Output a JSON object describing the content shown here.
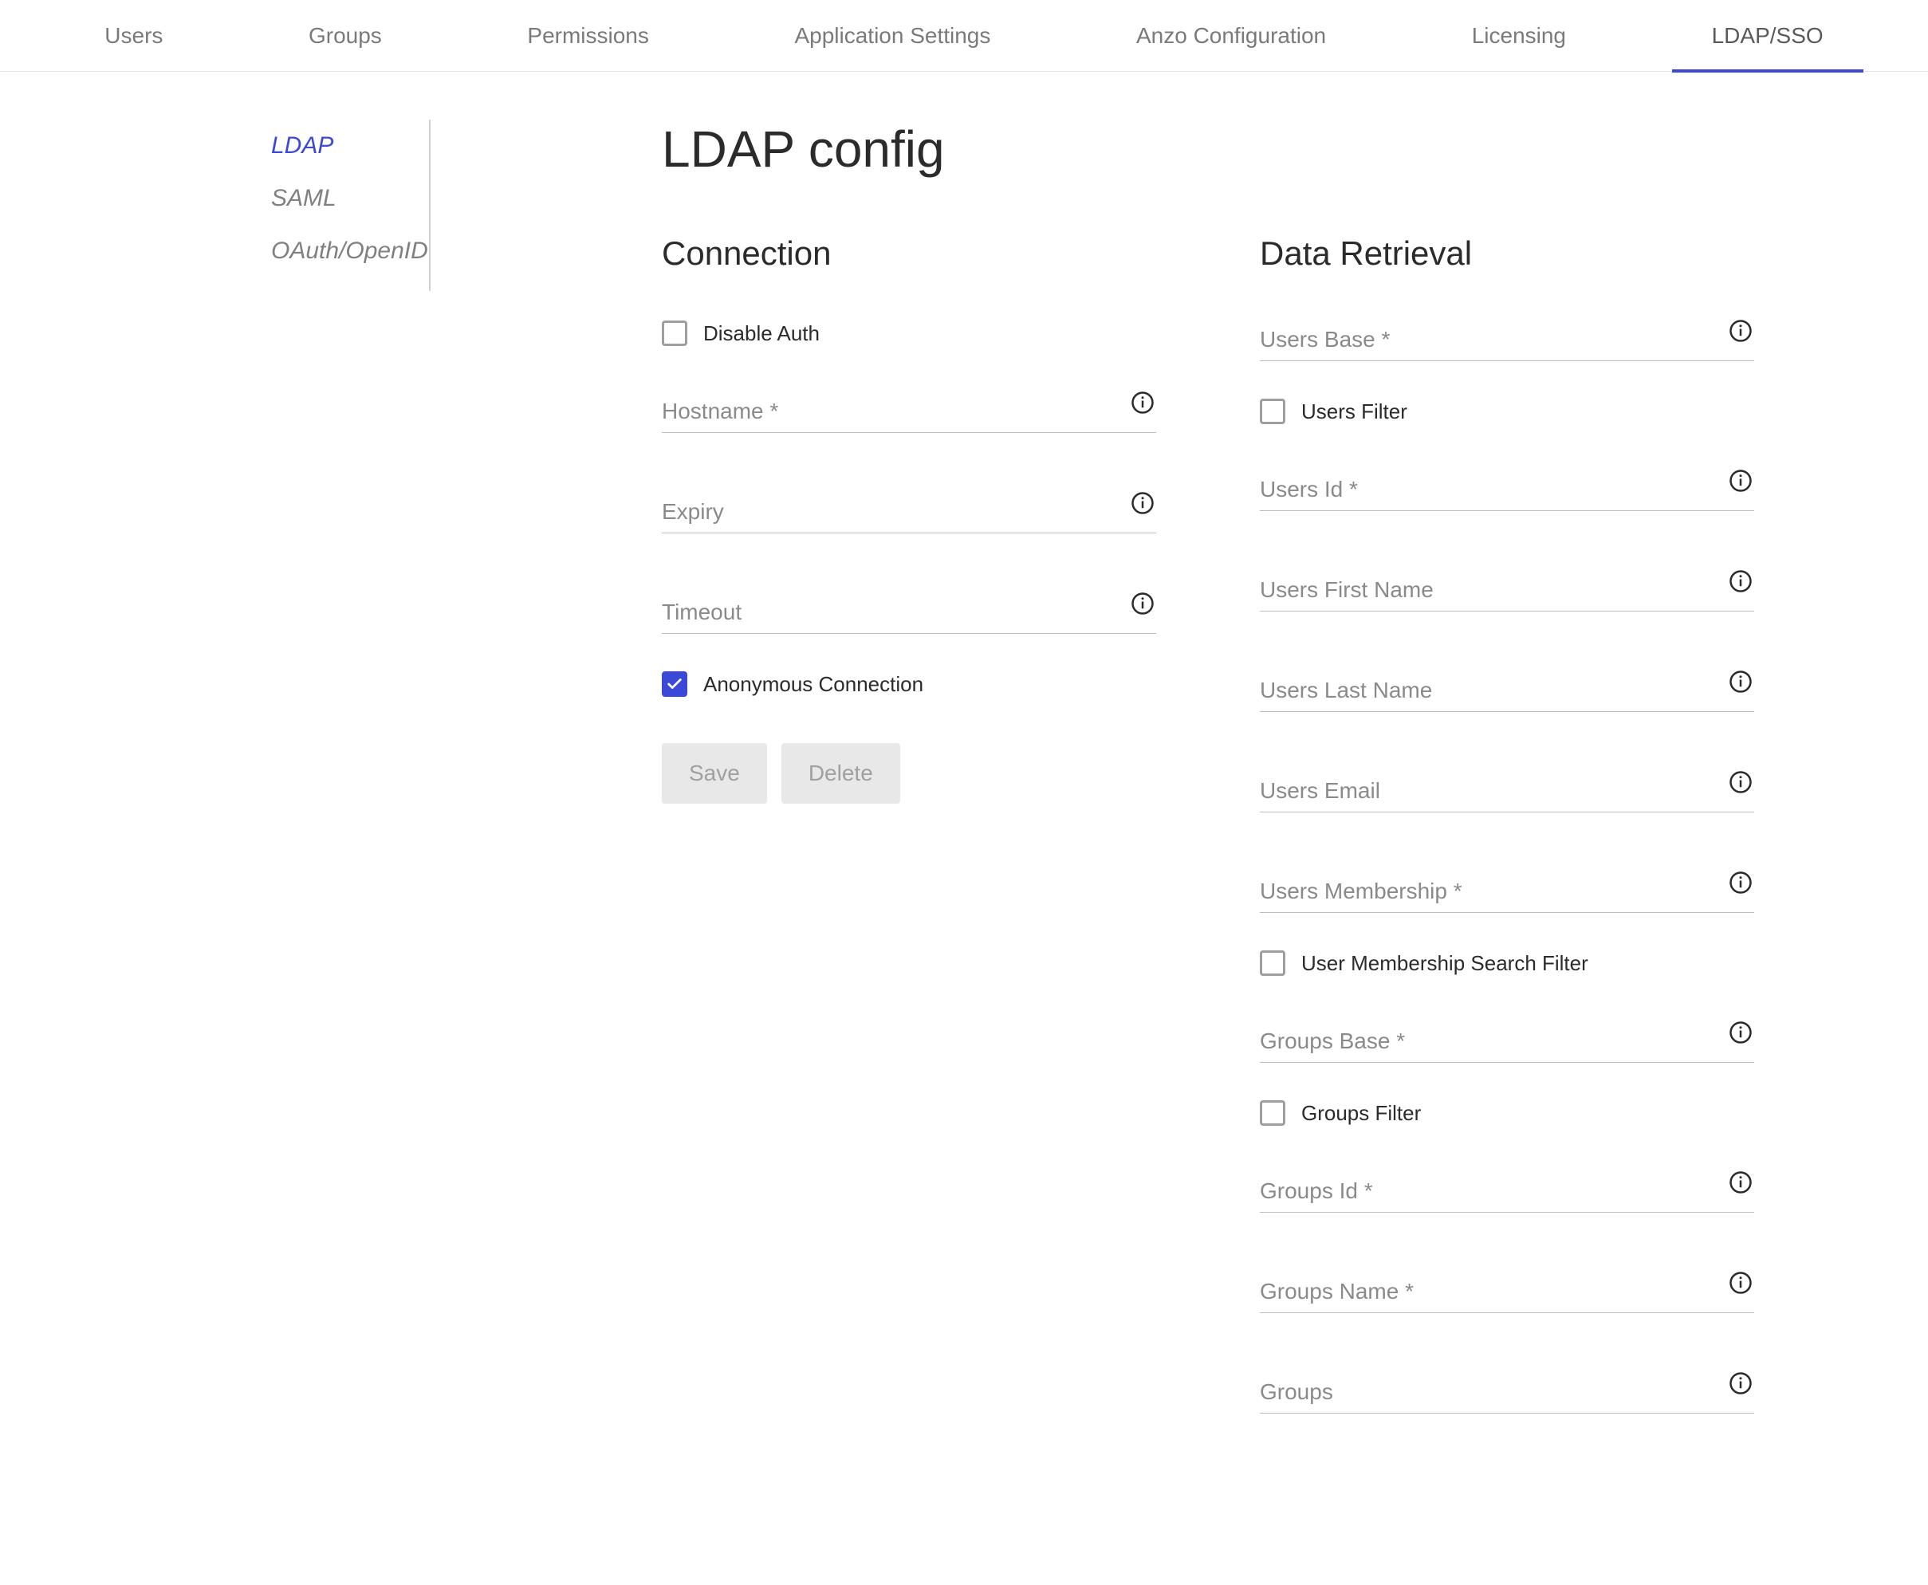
{
  "topnav": {
    "items": [
      {
        "label": "Users"
      },
      {
        "label": "Groups"
      },
      {
        "label": "Permissions"
      },
      {
        "label": "Application Settings"
      },
      {
        "label": "Anzo Configuration"
      },
      {
        "label": "Licensing"
      },
      {
        "label": "LDAP/SSO"
      }
    ],
    "active_index": 6
  },
  "sidebar": {
    "items": [
      {
        "label": "LDAP"
      },
      {
        "label": "SAML"
      },
      {
        "label": "OAuth/OpenID"
      }
    ],
    "active_index": 0
  },
  "page_title": "LDAP config",
  "connection": {
    "section_title": "Connection",
    "disable_auth_label": "Disable Auth",
    "disable_auth_checked": false,
    "hostname_placeholder": "Hostname *",
    "expiry_placeholder": "Expiry",
    "timeout_placeholder": "Timeout",
    "anonymous_connection_label": "Anonymous Connection",
    "anonymous_connection_checked": true,
    "save_label": "Save",
    "delete_label": "Delete"
  },
  "data_retrieval": {
    "section_title": "Data Retrieval",
    "users_base_placeholder": "Users Base *",
    "users_filter_label": "Users Filter",
    "users_filter_checked": false,
    "users_id_placeholder": "Users Id *",
    "users_first_name_placeholder": "Users First Name",
    "users_last_name_placeholder": "Users Last Name",
    "users_email_placeholder": "Users Email",
    "users_membership_placeholder": "Users Membership *",
    "user_membership_search_filter_label": "User Membership Search Filter",
    "user_membership_search_filter_checked": false,
    "groups_base_placeholder": "Groups Base *",
    "groups_filter_label": "Groups Filter",
    "groups_filter_checked": false,
    "groups_id_placeholder": "Groups Id *",
    "groups_name_placeholder": "Groups Name *",
    "groups_placeholder": "Groups"
  }
}
